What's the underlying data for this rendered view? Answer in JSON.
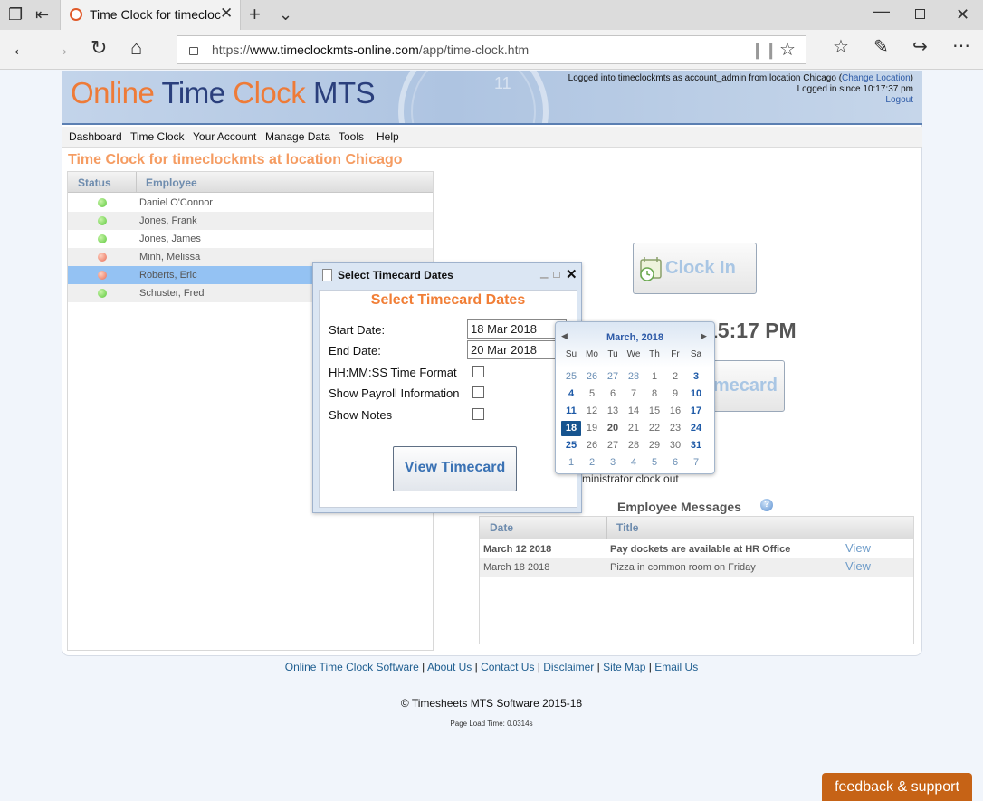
{
  "browser": {
    "tab_title": "Time Clock for timecloc",
    "url_prefix": "https://",
    "url_domain": "www.timeclockmts-online.com",
    "url_path": "/app/time-clock.htm"
  },
  "header": {
    "logo_online": "Online",
    "logo_time": "Time",
    "logo_clock": "Clock",
    "logo_mts": "MTS",
    "login_line1_prefix": "Logged into timeclockmts as account_admin from location Chicago (",
    "change_location": "Change Location",
    "login_line1_suffix": ")",
    "login_line2": "Logged in since 10:17:37 pm",
    "logout": "Logout"
  },
  "menu": [
    "Dashboard",
    "Time Clock",
    "Your Account",
    "Manage Data",
    "Tools",
    "Help"
  ],
  "page_title": "Time Clock for timeclockmts at location Chicago",
  "employee_table": {
    "columns": [
      "Status",
      "Employee"
    ],
    "rows": [
      {
        "name": "Daniel O'Connor",
        "status": "in",
        "color": "#5ac73a"
      },
      {
        "name": "Jones, Frank",
        "status": "in",
        "color": "#5ac73a"
      },
      {
        "name": "Jones, James",
        "status": "in",
        "color": "#5ac73a"
      },
      {
        "name": "Minh, Melissa",
        "status": "out",
        "color": "#e86c55"
      },
      {
        "name": "Roberts, Eric",
        "status": "out",
        "color": "#e86c55"
      },
      {
        "name": "Schuster, Fred",
        "status": "in",
        "color": "#5ac73a"
      }
    ]
  },
  "clock": {
    "clock_in_label": "Clock In",
    "time_partial": "15:17 PM",
    "timecard_partial": "mecard",
    "admin_note_partial": "ministrator clock out"
  },
  "messages": {
    "heading": "Employee Messages",
    "columns": [
      "Date",
      "Title"
    ],
    "rows": [
      {
        "date": "March 12 2018",
        "title": "Pay dockets are available at HR Office",
        "action": "View"
      },
      {
        "date": "March 18 2018",
        "title": "Pizza in common room on Friday",
        "action": "View"
      }
    ]
  },
  "dialog": {
    "title": "Select Timecard Dates",
    "heading": "Select Timecard Dates",
    "start_label": "Start Date:",
    "start_value": "18 Mar 2018",
    "end_label": "End Date:",
    "end_value": "20 Mar 2018",
    "opt_time_format": "HH:MM:SS Time Format",
    "opt_payroll": "Show Payroll Information",
    "opt_notes": "Show Notes",
    "view_button": "View Timecard"
  },
  "calendar": {
    "month": "March, 2018",
    "dow": [
      "Su",
      "Mo",
      "Tu",
      "We",
      "Th",
      "Fr",
      "Sa"
    ],
    "weeks": [
      [
        "25",
        "26",
        "27",
        "28",
        "1",
        "2",
        "3"
      ],
      [
        "4",
        "5",
        "6",
        "7",
        "8",
        "9",
        "10"
      ],
      [
        "11",
        "12",
        "13",
        "14",
        "15",
        "16",
        "17"
      ],
      [
        "18",
        "19",
        "20",
        "21",
        "22",
        "23",
        "24"
      ],
      [
        "25",
        "26",
        "27",
        "28",
        "29",
        "30",
        "31"
      ],
      [
        "1",
        "2",
        "3",
        "4",
        "5",
        "6",
        "7"
      ]
    ],
    "selected": "18"
  },
  "footer": {
    "links": [
      "Online Time Clock Software",
      "About Us",
      "Contact Us",
      "Disclaimer",
      "Site Map",
      "Email Us"
    ],
    "copyright": "© Timesheets MTS Software 2015-18",
    "load_time": "Page Load Time: 0.0314s",
    "feedback": "feedback & support"
  },
  "colors": {
    "accent_orange": "#f17e36",
    "link_blue": "#1f5e90",
    "selected_row": "#94c2f3",
    "calendar_selected": "#16548f"
  }
}
